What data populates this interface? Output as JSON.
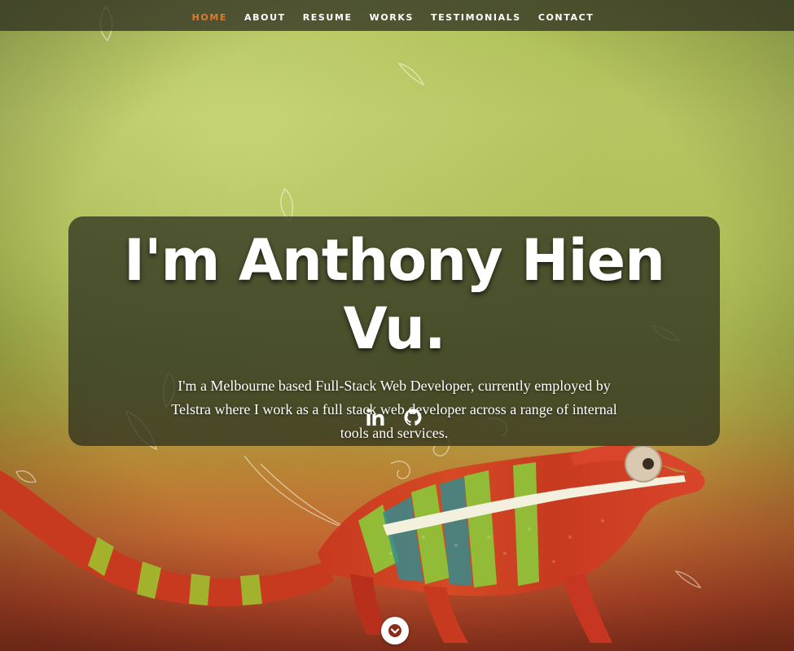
{
  "nav": {
    "items": [
      {
        "label": "Home",
        "active": true
      },
      {
        "label": "About",
        "active": false
      },
      {
        "label": "Resume",
        "active": false
      },
      {
        "label": "Works",
        "active": false
      },
      {
        "label": "Testimonials",
        "active": false
      },
      {
        "label": "Contact",
        "active": false
      }
    ],
    "active_color": "#e07b30"
  },
  "hero": {
    "title": "I'm Anthony Hien Vu.",
    "description": "I'm a Melbourne based Full-Stack Web Developer, currently employed by Telstra where I work as a full stack web developer across a range of internal tools and services.",
    "socials": [
      {
        "icon": "linkedin-icon"
      },
      {
        "icon": "github-icon"
      }
    ]
  },
  "scroll": {
    "icon": "chevron-down-icon"
  },
  "background": {
    "image": "chameleon-icon",
    "top_color": "#a9bb4c",
    "bottom_color": "#8b2a14"
  }
}
